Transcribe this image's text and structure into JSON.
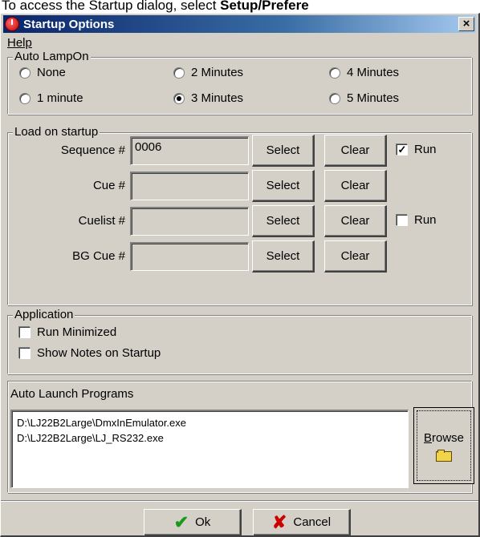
{
  "caption": {
    "lead": "To access the Startup dialog, select ",
    "bold": "Setup/Prefere"
  },
  "window": {
    "title": "Startup Options",
    "close_glyph": "×"
  },
  "menu": {
    "help": "Help"
  },
  "auto_lamp_on": {
    "label": "Auto LampOn",
    "options": [
      {
        "label": "None",
        "checked": false
      },
      {
        "label": "2 Minutes",
        "checked": false
      },
      {
        "label": "4 Minutes",
        "checked": false
      },
      {
        "label": "1 minute",
        "checked": false
      },
      {
        "label": "3 Minutes",
        "checked": true
      },
      {
        "label": "5 Minutes",
        "checked": false
      }
    ]
  },
  "load_on_startup": {
    "label": "Load on startup",
    "select_label": "Select",
    "clear_label": "Clear",
    "run_label": "Run",
    "rows": [
      {
        "label": "Sequence #",
        "value": "0006",
        "run": true
      },
      {
        "label": "Cue #",
        "value": ""
      },
      {
        "label": "Cuelist #",
        "value": "",
        "run": false
      },
      {
        "label": "BG Cue #",
        "value": ""
      }
    ]
  },
  "application": {
    "label": "Application",
    "options": [
      {
        "label": "Run Minimized",
        "checked": false
      },
      {
        "label": "Show Notes on Startup",
        "checked": false
      }
    ]
  },
  "auto_launch": {
    "label": "Auto Launch Programs",
    "items": [
      "D:\\LJ22B2Large\\DmxInEmulator.exe",
      "D:\\LJ22B2Large\\LJ_RS232.exe"
    ],
    "browse_first": "B",
    "browse_rest": "rowse"
  },
  "footer": {
    "ok": "Ok",
    "cancel": "Cancel"
  }
}
